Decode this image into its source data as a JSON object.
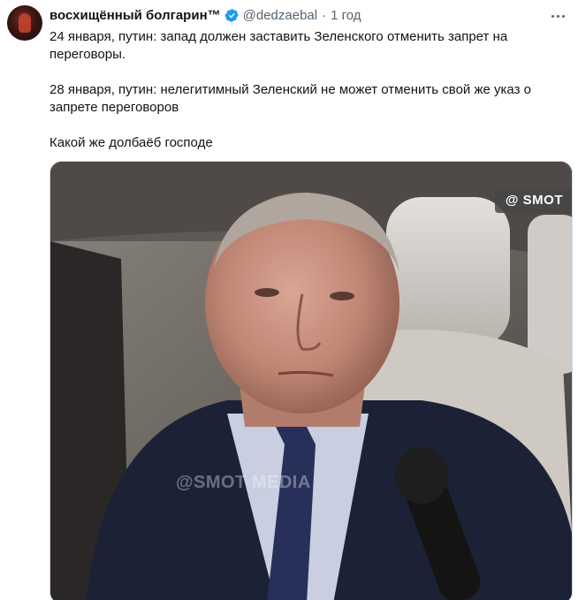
{
  "author": {
    "display_name": "восхищённый болгарин™",
    "handle": "@dedzaebal",
    "separator": "·",
    "timestamp": "1 год",
    "verified": true
  },
  "tweet": {
    "paragraphs": [
      "24 января, путин: запад должен заставить Зеленского отменить запрет на переговоры.",
      "28 января, путин: нелегитимный Зеленский не может отменить свой же указ о запрете переговоров",
      "Какой же долбаёб господе"
    ]
  },
  "media": {
    "watermark_badge": "@ SMOT",
    "watermark_center": "@SMOT    MEDIA"
  },
  "colors": {
    "text_primary": "#0f1419",
    "text_secondary": "#536471",
    "verified_blue": "#1d9bf0",
    "border": "#cfd9de"
  },
  "icons": {
    "more": "more-horizontal-icon",
    "verified": "verified-badge-icon"
  }
}
